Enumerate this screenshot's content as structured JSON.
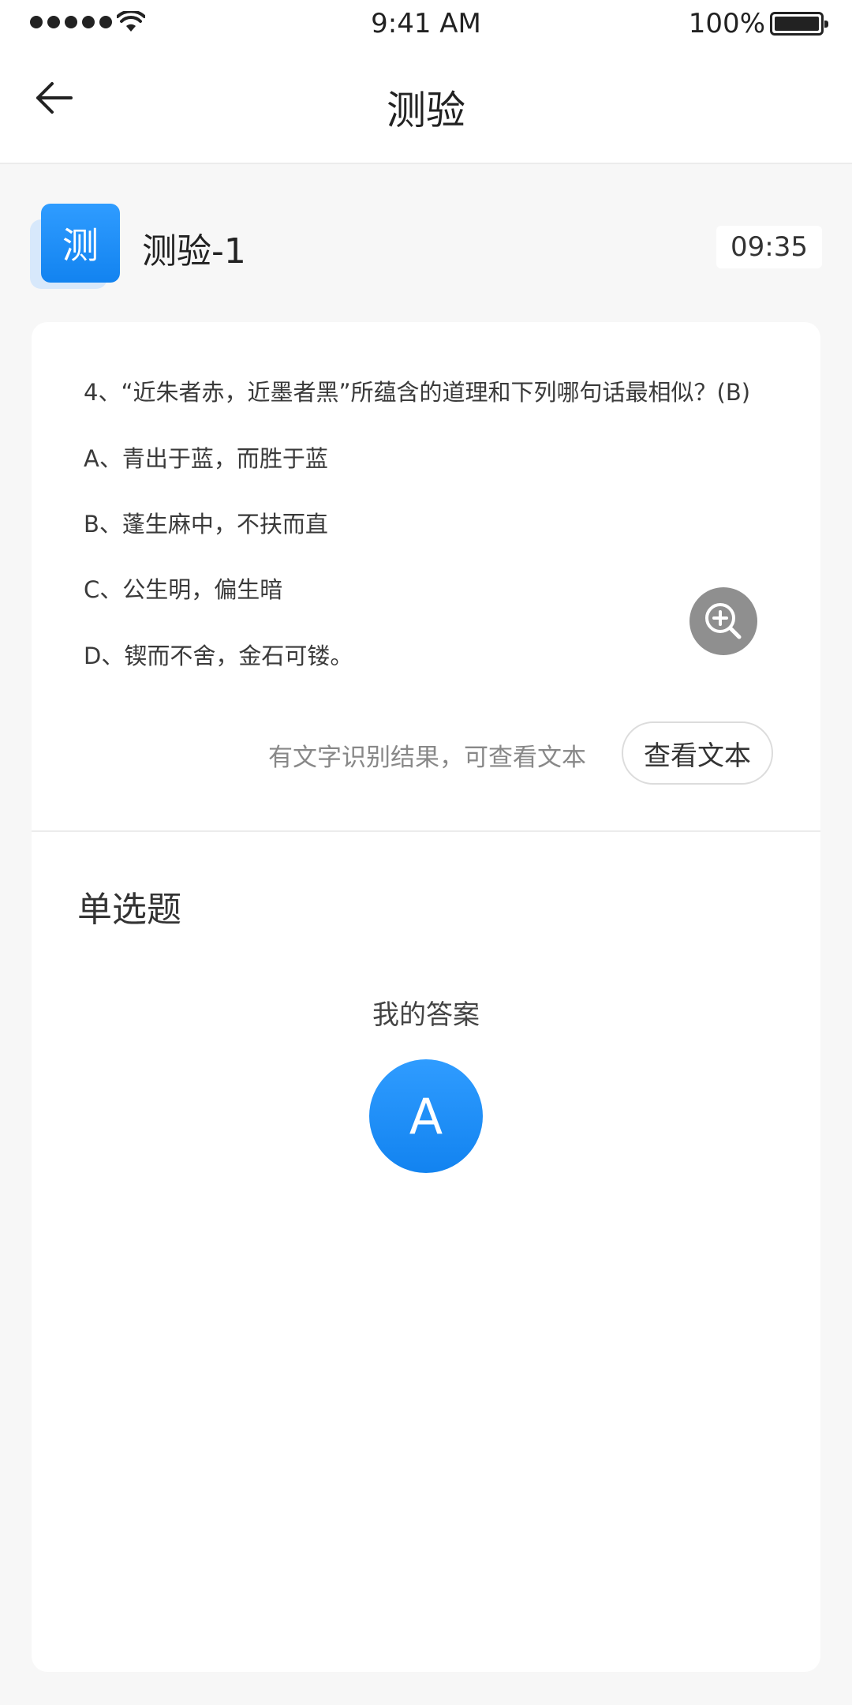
{
  "status_bar": {
    "time": "9:41 AM",
    "battery": "100%"
  },
  "nav": {
    "title": "测验"
  },
  "test": {
    "icon_char": "测",
    "name": "测验-1",
    "timer": "09:35"
  },
  "question": {
    "lines": [
      "4、“近朱者赤，近墨者黑”所蕴含的道理和下列哪句话最相似？(B)",
      "A、青出于蓝，而胜于蓝",
      "B、蓬生麻中，不扶而直",
      "C、公生明，偏生暗",
      "D、锲而不舍，金石可镂。"
    ]
  },
  "ocr": {
    "hint": "有文字识别结果，可查看文本",
    "button": "查看文本"
  },
  "answer": {
    "type": "单选题",
    "label": "我的答案",
    "value": "A"
  },
  "colors": {
    "accent": "#1283f0",
    "accent_light": "#2f9cff"
  },
  "icons": [
    "back-arrow-icon",
    "zoom-in-icon",
    "wifi-icon",
    "battery-icon"
  ]
}
